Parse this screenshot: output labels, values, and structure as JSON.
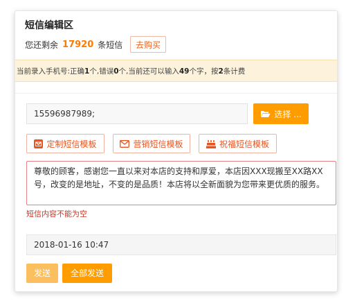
{
  "header": {
    "title": "短信编辑区",
    "remain_prefix": "您还剩余",
    "remain_count": "17920",
    "remain_suffix": "条短信",
    "buy_label": "去购买"
  },
  "notice": {
    "p1": "当前录入手机号:正确",
    "correct": "1",
    "p2": "个,错误",
    "wrong": "0",
    "p3": "个,当前还可以输入",
    "chars": "49",
    "p4": "个字，按",
    "fee": "2",
    "p5": "条计费"
  },
  "phone": {
    "value": "15596987989;"
  },
  "select": {
    "label": "选择 ..."
  },
  "templates": [
    {
      "label": "定制短信模板"
    },
    {
      "label": "营销短信模板"
    },
    {
      "label": "祝福短信模板"
    }
  ],
  "sms": {
    "content": "尊敬的顾客，感谢您一直以来对本店的支持和厚爱，本店因XXX现搬至XX路XX号，改变的是地址，不变的是品质！本店将以全新面貌为您带来更优质的服务。"
  },
  "error": {
    "text": "短信内容不能为空"
  },
  "send_time": {
    "value": "2018-01-16 10:47"
  },
  "actions": {
    "send": "发送",
    "send_all": "全部发送"
  },
  "colors": {
    "accent": "#ff9d00",
    "error": "#c0392b",
    "template_text": "#e8541f"
  }
}
